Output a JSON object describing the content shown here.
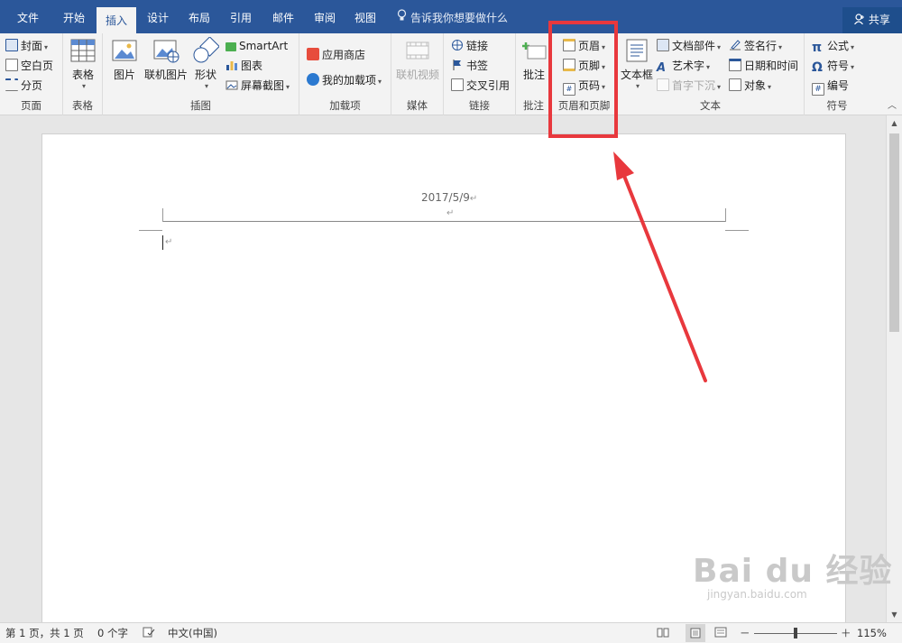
{
  "tabs": [
    {
      "label": "文件"
    },
    {
      "label": "开始"
    },
    {
      "label": "插入"
    },
    {
      "label": "设计"
    },
    {
      "label": "布局"
    },
    {
      "label": "引用"
    },
    {
      "label": "邮件"
    },
    {
      "label": "审阅"
    },
    {
      "label": "视图"
    }
  ],
  "active_tab": "插入",
  "tell_me": "告诉我你想要做什么",
  "share": "共享",
  "groups": {
    "pages": {
      "label": "页面",
      "cover": "封面",
      "blank": "空白页",
      "break": "分页"
    },
    "tables": {
      "label": "表格",
      "table": "表格"
    },
    "illustrations": {
      "label": "插图",
      "picture": "图片",
      "online_picture": "联机图片",
      "shapes": "形状",
      "smartart": "SmartArt",
      "chart": "图表",
      "screenshot": "屏幕截图"
    },
    "addins": {
      "label": "加载项",
      "store": "应用商店",
      "my_addins": "我的加载项"
    },
    "media": {
      "label": "媒体",
      "online_video": "联机视频"
    },
    "links": {
      "label": "链接",
      "link": "链接",
      "bookmark": "书签",
      "cross_ref": "交叉引用"
    },
    "comments": {
      "label": "批注",
      "comment": "批注"
    },
    "header_footer": {
      "label": "页眉和页脚",
      "header": "页眉",
      "footer": "页脚",
      "page_number": "页码"
    },
    "text": {
      "label": "文本",
      "textbox": "文本框",
      "quick_parts": "文档部件",
      "wordart": "艺术字",
      "drop_cap": "首字下沉",
      "signature": "签名行",
      "datetime": "日期和时间",
      "object": "对象"
    },
    "symbols": {
      "label": "符号",
      "equation": "公式",
      "symbol": "符号",
      "number": "编号"
    }
  },
  "document": {
    "header_text": "2017/5/9",
    "para_mark": "↵"
  },
  "status": {
    "page": "第 1 页，共 1 页",
    "words": "0 个字",
    "language": "中文(中国)",
    "zoom": "115%",
    "zoom_minus": "－",
    "zoom_plus": "＋"
  },
  "watermark": {
    "brand": "Bai du 经验",
    "url": "jingyan.baidu.com"
  },
  "colors": {
    "accent": "#2b579a",
    "annotation": "#e8383d"
  }
}
